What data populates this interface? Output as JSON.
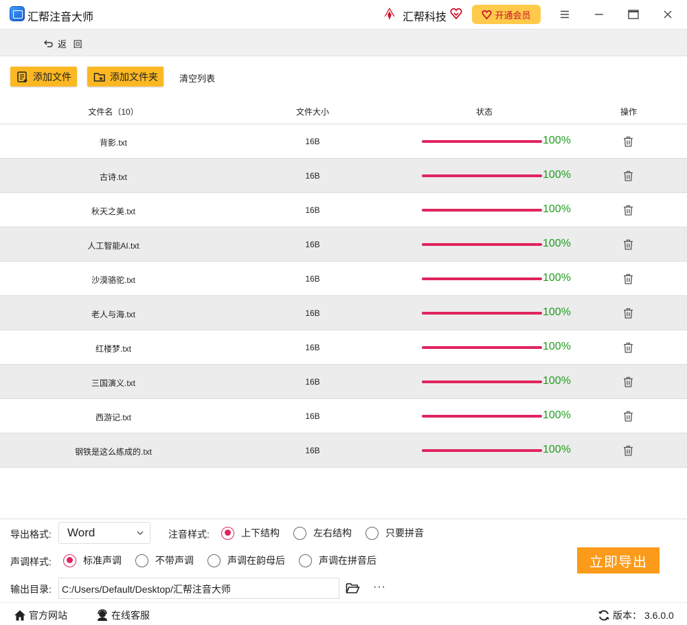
{
  "app": {
    "title": "汇帮注音大师",
    "brand_name": "汇帮科技",
    "vip_label": "开通会员"
  },
  "nav": {
    "back_label": "返 回"
  },
  "toolbar": {
    "add_file_label": "添加文件",
    "add_folder_label": "添加文件夹",
    "clear_label": "清空列表"
  },
  "table": {
    "headers": {
      "name": "文件名（10）",
      "size": "文件大小",
      "status": "状态",
      "action": "操作"
    },
    "rows": [
      {
        "name": "背影.txt",
        "size": "16B",
        "progress": "100%"
      },
      {
        "name": "古诗.txt",
        "size": "16B",
        "progress": "100%"
      },
      {
        "name": "秋天之美.txt",
        "size": "16B",
        "progress": "100%"
      },
      {
        "name": "人工智能AI.txt",
        "size": "16B",
        "progress": "100%"
      },
      {
        "name": "沙漠骆驼.txt",
        "size": "16B",
        "progress": "100%"
      },
      {
        "name": "老人与海.txt",
        "size": "16B",
        "progress": "100%"
      },
      {
        "name": "红楼梦.txt",
        "size": "16B",
        "progress": "100%"
      },
      {
        "name": "三国演义.txt",
        "size": "16B",
        "progress": "100%"
      },
      {
        "name": "西游记.txt",
        "size": "16B",
        "progress": "100%"
      },
      {
        "name": "钢铁是这么练成的.txt",
        "size": "16B",
        "progress": "100%"
      }
    ]
  },
  "settings": {
    "format_label": "导出格式:",
    "format_value": "Word",
    "annotation_label": "注音样式:",
    "annotation_options": [
      "上下结构",
      "左右结构",
      "只要拼音"
    ],
    "annotation_selected": 0,
    "tone_label": "声调样式:",
    "tone_options": [
      "标准声调",
      "不带声调",
      "声调在韵母后",
      "声调在拼音后"
    ],
    "tone_selected": 0,
    "output_label": "输出目录:",
    "output_path": "C:/Users/Default/Desktop/汇帮注音大师",
    "more_label": "···",
    "export_label": "立即导出"
  },
  "footer": {
    "website_label": "官方网站",
    "support_label": "在线客服",
    "version_label": "版本：",
    "version_value": "3.6.0.0"
  },
  "colors": {
    "accent": "#fcb823",
    "export": "#fc9a19",
    "progress": "#e0245e",
    "percent_text": "#1f9d1f"
  }
}
